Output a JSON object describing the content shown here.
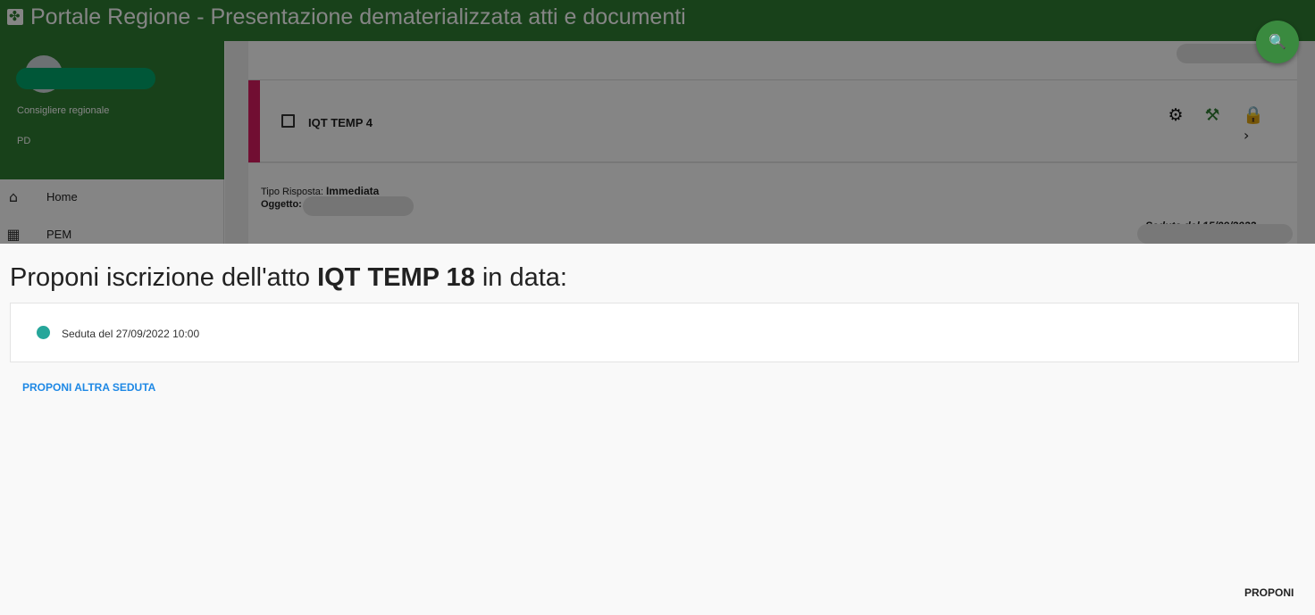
{
  "app": {
    "title": "Portale Regione - Presentazione dematerializzata atti e documenti"
  },
  "profile": {
    "role": "Consigliere regionale",
    "party": "PD"
  },
  "nav": {
    "items": [
      {
        "label": "Home",
        "icon": "home-icon"
      },
      {
        "label": "PEM",
        "icon": "calendar-icon"
      }
    ]
  },
  "act_card": {
    "name": "IQT TEMP 4",
    "tipo_label": "Tipo Risposta:",
    "tipo_value": "Immediata",
    "oggetto_label": "Oggetto:",
    "seduta_partial": "Seduta del 15/09/2022",
    "accent_color": "#d81b60"
  },
  "dialog": {
    "title_prefix": "Proponi iscrizione dell'atto",
    "act_id": "IQT TEMP 18",
    "title_suffix": "in data:",
    "options": [
      {
        "label": "Seduta del 27/09/2022 10:00",
        "selected": true
      }
    ],
    "link_label": "PROPONI ALTRA SEDUTA",
    "submit_label": "PROPONI"
  },
  "colors": {
    "brand_green": "#2e7d32",
    "link_blue": "#1e88e5",
    "radio_teal": "#26a69a"
  }
}
